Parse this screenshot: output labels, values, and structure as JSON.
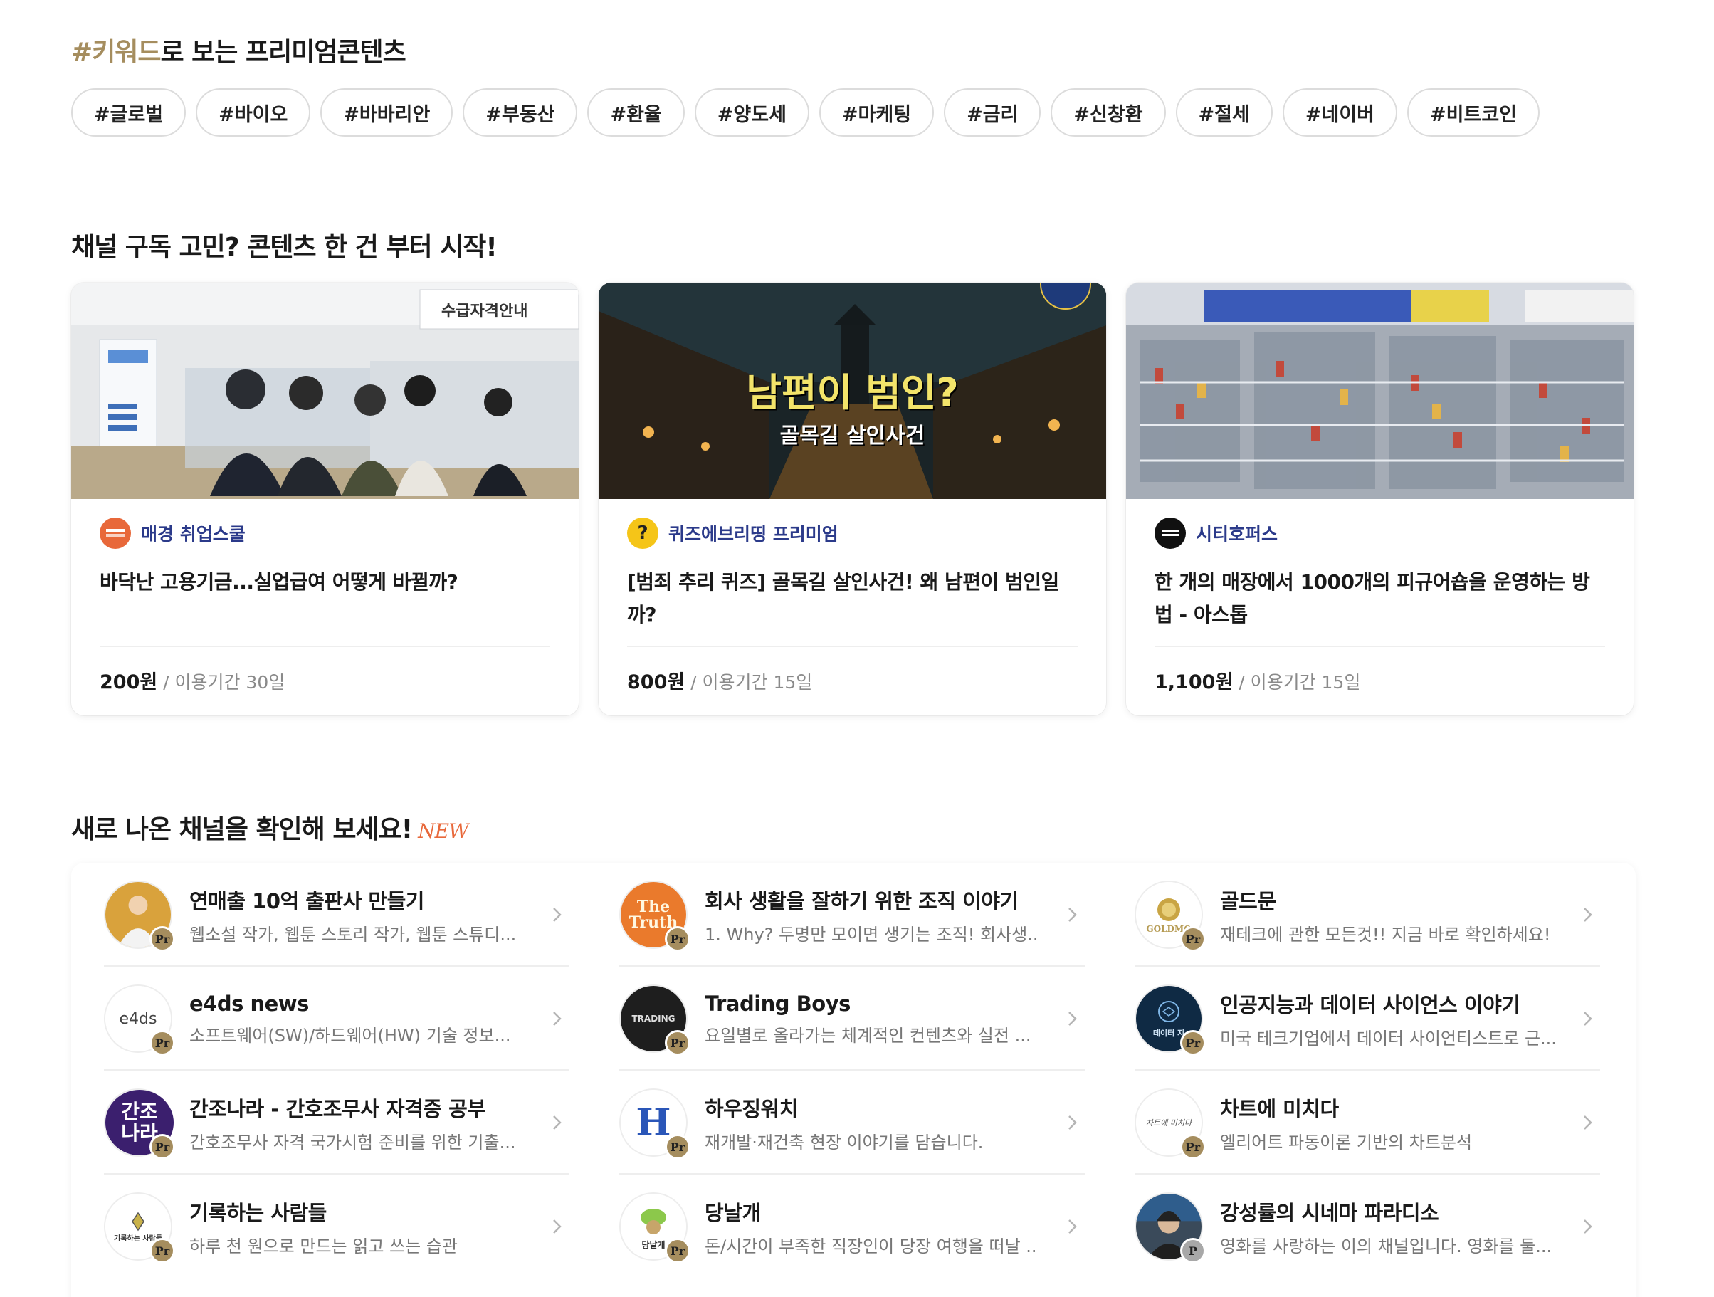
{
  "keywords": {
    "title_accent": "#키워드",
    "title_rest": "로 보는 프리미엄콘텐츠",
    "chips": [
      "#글로벌",
      "#바이오",
      "#바바리안",
      "#부동산",
      "#환율",
      "#양도세",
      "#마케팅",
      "#금리",
      "#신창환",
      "#절세",
      "#네이버",
      "#비트코인"
    ]
  },
  "sections": {
    "single_content_title": "채널 구독 고민? 콘텐츠 한 건 부터 시작!",
    "new_channels_title": "새로 나온 채널을 확인해 보세요!",
    "new_tag": "NEW"
  },
  "cards": [
    {
      "channel": "매경 취업스쿨",
      "title": "바닥난 고용기금...실업급여 어떻게 바뀔까?",
      "price": "200원",
      "period": " / 이용기간 30일",
      "image_sign": "수급자격안내",
      "logo_color": "#e8683a"
    },
    {
      "channel": "퀴즈에브리띵 프리미엄",
      "title": "[범죄 추리 퀴즈] 골목길 살인사건! 왜 남편이 범인일까?",
      "price": "800원",
      "period": " / 이용기간 15일",
      "image_text_main": "남편이 범인?",
      "image_text_sub": "골목길 살인사건",
      "logo_color": "#f5c518"
    },
    {
      "channel": "시티호퍼스",
      "title": "한 개의 매장에서 1000개의 피규어숍을 운영하는 방법 - 아스톱",
      "price": "1,100원",
      "period": " / 이용기간 15일",
      "logo_color": "#111111"
    }
  ],
  "channels": [
    {
      "title": "연매출 10억 출판사 만들기",
      "desc": "웹소설 작가, 웹툰 스토리 작가, 웹툰 스튜디...",
      "badge": "Pr",
      "avatar_bg": "#d9a23c",
      "avatar_text": ""
    },
    {
      "title": "회사 생활을 잘하기 위한 조직 이야기",
      "desc": "1. Why? 두명만 모이면 생기는 조직! 회사생...",
      "badge": "Pr",
      "avatar_bg": "#ea7a2c",
      "avatar_text": "The Truth"
    },
    {
      "title": "골드문",
      "desc": "재테크에 관한 모든것!! 지금 바로 확인하세요!",
      "badge": "Pr",
      "avatar_bg": "#ffffff",
      "avatar_text": "GOLDMO"
    },
    {
      "title": "e4ds news",
      "desc": "소프트웨어(SW)/하드웨어(HW) 기술 정보...",
      "badge": "Pr",
      "avatar_bg": "#ffffff",
      "avatar_text": "e4ds"
    },
    {
      "title": "Trading Boys",
      "desc": "요일별로 올라가는 체계적인 컨텐츠와 실전 ...",
      "badge": "Pr",
      "avatar_bg": "#1e1e1e",
      "avatar_text": "TRADING"
    },
    {
      "title": "인공지능과 데이터 사이언스 이야기",
      "desc": "미국 테크기업에서 데이터 사이언티스트로 근...",
      "badge": "Pr",
      "avatar_bg": "#0f2a44",
      "avatar_text": "데이터 지"
    },
    {
      "title": "간조나라 - 간호조무사 자격증 공부",
      "desc": "간호조무사 자격 국가시험 준비를 위한 기출...",
      "badge": "Pr",
      "avatar_bg": "#3b1f6e",
      "avatar_text": "간조나라"
    },
    {
      "title": "하우징워치",
      "desc": "재개발·재건축 현장 이야기를 담습니다.",
      "badge": "Pr",
      "avatar_bg": "#ffffff",
      "avatar_text": "H"
    },
    {
      "title": "차트에 미치다",
      "desc": "엘리어트 파동이론 기반의 차트분석",
      "badge": "Pr",
      "avatar_bg": "#ffffff",
      "avatar_text": "차트에 미치다"
    },
    {
      "title": "기록하는 사람들",
      "desc": "하루 천 원으로 만드는 읽고 쓰는 습관",
      "badge": "Pr",
      "avatar_bg": "#ffffff",
      "avatar_text": "기록하는 사람들"
    },
    {
      "title": "당날개",
      "desc": "돈/시간이 부족한 직장인이 당장 여행을 떠날 ...",
      "badge": "Pr",
      "avatar_bg": "#ffffff",
      "avatar_text": "당날개"
    },
    {
      "title": "강성률의 시네마 파라디소",
      "desc": "영화를 사랑하는 이의 채널입니다. 영화를 둘...",
      "badge": "P",
      "avatar_bg": "#3a4a5a",
      "avatar_text": ""
    }
  ],
  "colors": {
    "accent_gold": "#a58d5e",
    "channel_blue": "#2b3a8a",
    "new_orange": "#e8683a"
  }
}
